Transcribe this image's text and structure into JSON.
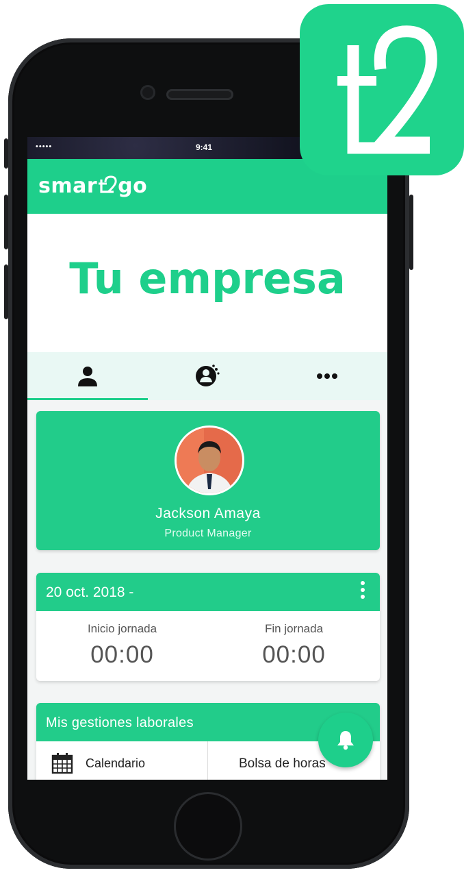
{
  "status_bar": {
    "signal": "••••• ",
    "time": "9:41"
  },
  "app_bar": {
    "brand": "smart2go",
    "brand_prefix": "smar",
    "brand_suffix": "go"
  },
  "hero": {
    "title": "Tu empresa"
  },
  "tabs": [
    {
      "icon": "person-icon",
      "active": true
    },
    {
      "icon": "team-icon",
      "active": false
    },
    {
      "icon": "more-icon",
      "active": false
    }
  ],
  "profile": {
    "name": "Jackson Amaya",
    "role": "Product Manager"
  },
  "workday": {
    "date": "20 oct. 2018 -",
    "start_label": "Inicio jornada",
    "start_value": "00:00",
    "end_label": "Fin jornada",
    "end_value": "00:00"
  },
  "gestiones": {
    "title": "Mis gestiones laborales",
    "calendar_label": "Calendario",
    "hours_label": "Bolsa de horas"
  },
  "colors": {
    "accent": "#1ecf8b",
    "tab_bg": "#e9f8f4",
    "text": "#555555"
  },
  "logo_badge": {
    "text": "t2"
  }
}
